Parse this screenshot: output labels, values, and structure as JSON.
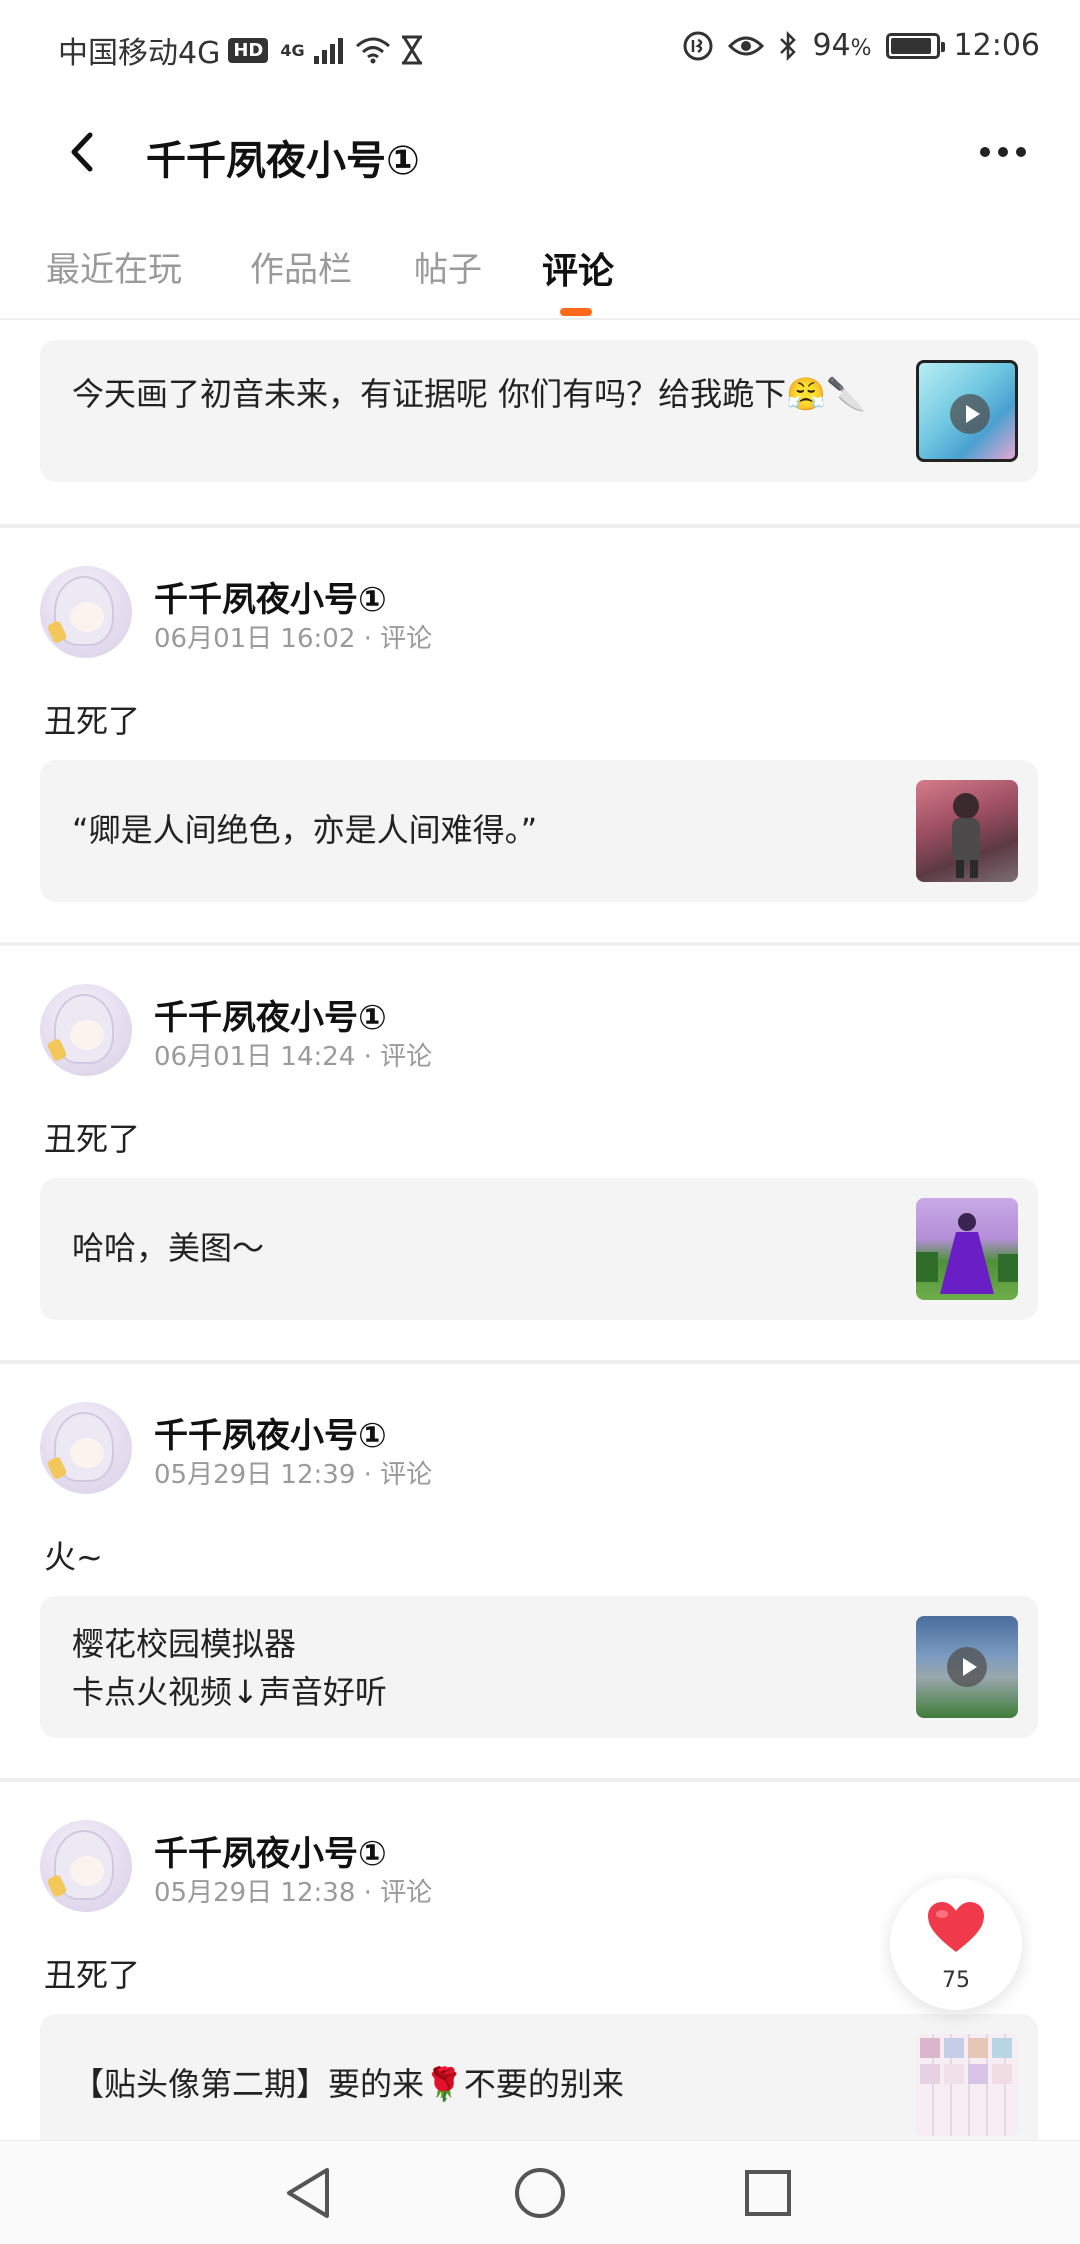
{
  "status_bar": {
    "carrier": "中国移动4G",
    "hd_badge": "HD",
    "network": "4G",
    "battery_text": "94",
    "battery_unit": "%",
    "time": "12:06"
  },
  "header": {
    "title": "千千夙夜小号①"
  },
  "tabs": [
    {
      "label": "最近在玩",
      "active": false
    },
    {
      "label": "作品栏",
      "active": false
    },
    {
      "label": "帖子",
      "active": false
    },
    {
      "label": "评论",
      "active": true
    }
  ],
  "feed": {
    "top_quote": {
      "text": "今天画了初音未来，有证据呢 你们有吗？给我跪下😤🔪"
    },
    "posts": [
      {
        "author": "千千夙夜小号①",
        "meta": "06月01日 16:02 · 评论",
        "comment": "丑死了",
        "quote": "“卿是人间绝色，亦是人间难得。”"
      },
      {
        "author": "千千夙夜小号①",
        "meta": "06月01日 14:24 · 评论",
        "comment": "丑死了",
        "quote": "哈哈，美图～"
      },
      {
        "author": "千千夙夜小号①",
        "meta": "05月29日 12:39 · 评论",
        "comment": "火~",
        "quote_line1": "樱花校园模拟器",
        "quote_line2": "卡点火视频↓声音好听"
      },
      {
        "author": "千千夙夜小号①",
        "meta": "05月29日 12:38 · 评论",
        "comment": "丑死了",
        "quote": "【贴头像第二期】要的来🌹不要的别来"
      }
    ]
  },
  "like": {
    "count": "75"
  },
  "colors": {
    "accent": "#ff6a1a",
    "like_red": "#f0394a"
  }
}
